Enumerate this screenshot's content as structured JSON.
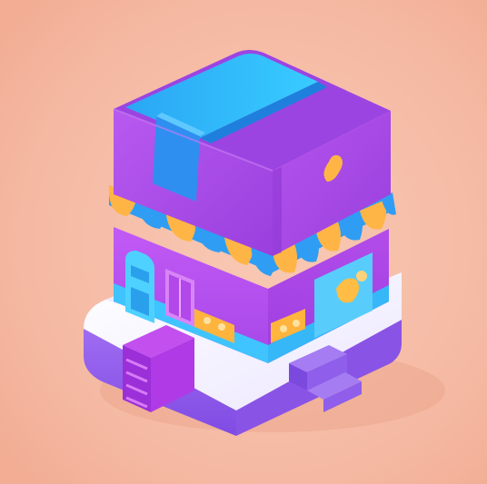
{
  "scene": {
    "subject": "isometric-shop-building-illustration",
    "colors": {
      "background": "#f5b9a3",
      "background_glow": "#f7c3ad",
      "background_warm": "#f3a98f",
      "roof_purple": "#a652e6",
      "roof_purple_dark": "#8a34d2",
      "roof_purple_left": "#b04ee0",
      "roof_top_cyan": "#3fd2ff",
      "roof_top_blue": "#2a9df4",
      "ribbon_blue": "#2f8ff0",
      "awning_orange": "#ffb545",
      "awning_blue": "#2f9df4",
      "wall_purple": "#b248e8",
      "wall_cyan": "#3fc4ff",
      "door_cyan": "#56d9ff",
      "base_white": "#f3f0ff",
      "base_lavender": "#9b67f0",
      "base_lavender_dark": "#7a46e3",
      "steps_magenta": "#b137e0",
      "sign_orange": "#ffb13b"
    },
    "icons": [
      "door-icon",
      "window-icon",
      "sign-icon",
      "orange-sign-icon",
      "step-stairs-icon"
    ]
  }
}
